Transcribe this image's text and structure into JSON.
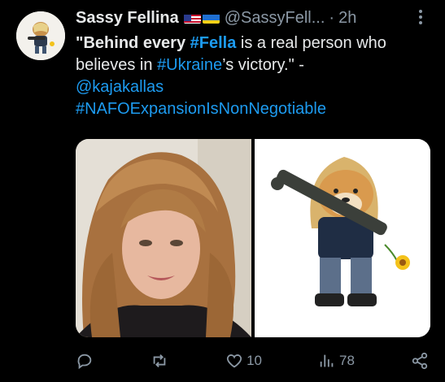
{
  "tweet": {
    "author_name": "Sassy Fellina",
    "handle": "@SassyFell...",
    "separator": "·",
    "time": "2h",
    "text": {
      "quote_open": "\"",
      "part1": "Behind every ",
      "hashtag_fella": "#Fella",
      "part2": " is a real person who believes in ",
      "hashtag_ukraine": "#Ukraine",
      "part3": "’s victory.\" -",
      "mention": "@kajakallas",
      "hashtag_nafo": "#NAFOExpansionIsNonNegotiable"
    }
  },
  "actions": {
    "like_count": "10",
    "views_count": "78"
  },
  "colors": {
    "background": "#000000",
    "text": "#e7e9ea",
    "secondary": "#8b98a5",
    "link": "#1d9bf0"
  },
  "icons": {
    "more": "more-dots-icon",
    "reply": "reply-icon",
    "retweet": "retweet-icon",
    "like": "heart-icon",
    "views": "views-icon",
    "share": "share-icon"
  }
}
